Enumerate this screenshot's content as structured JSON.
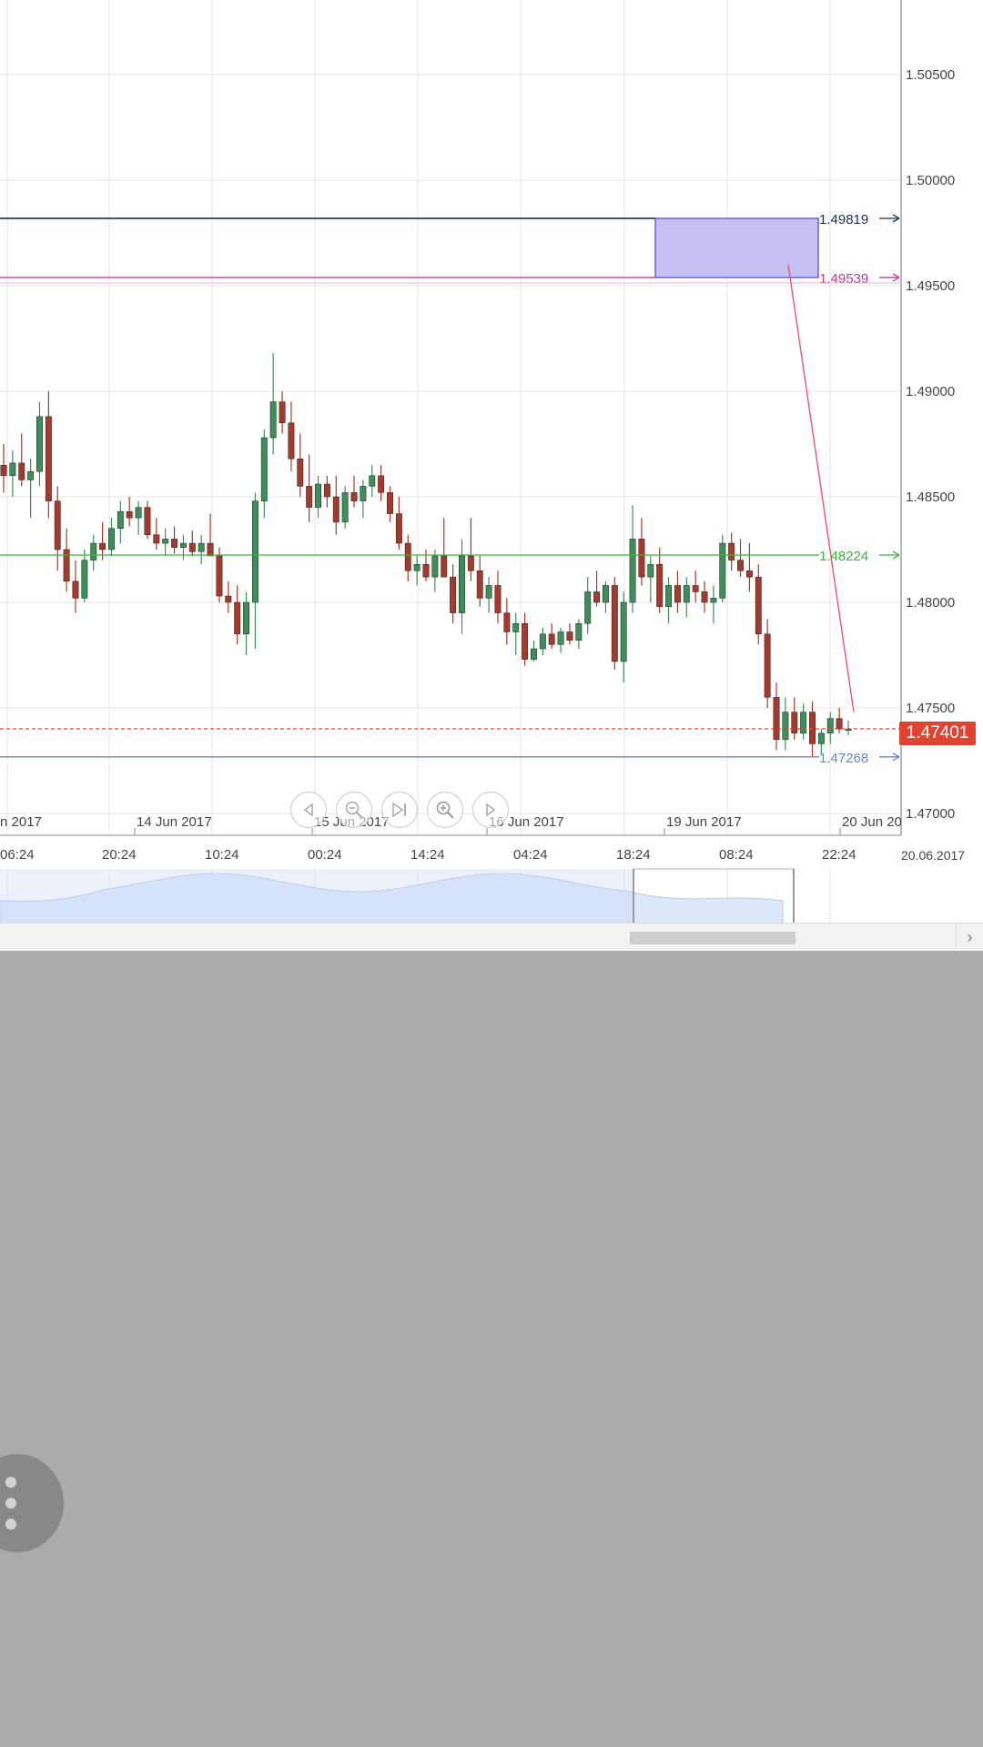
{
  "chart_data": {
    "type": "candlestick",
    "y_axis_ticks": [
      "1.50500",
      "1.50000",
      "1.49500",
      "1.49000",
      "1.48500",
      "1.48000",
      "1.47500",
      "1.47000"
    ],
    "y_axis_values": [
      1.505,
      1.5,
      1.495,
      1.49,
      1.485,
      1.48,
      1.475,
      1.47
    ],
    "ylim": [
      1.4684,
      1.5089
    ],
    "date_labels": [
      "n 2017",
      "14 Jun 2017",
      "15 Jun 2017",
      "16 Jun 2017",
      "19 Jun 2017",
      "20 Jun 20"
    ],
    "time_labels": [
      "06:24",
      "20:24",
      "10:24",
      "00:24",
      "14:24",
      "04:24",
      "18:24",
      "08:24",
      "22:24"
    ],
    "corner_date": "20.06.2017",
    "current_price": 1.47401,
    "current_price_label": "1.47401",
    "horizontal_lines": [
      {
        "value": 1.49819,
        "label": "1.49819",
        "color": "#1f2a5a"
      },
      {
        "value": 1.49539,
        "label": "1.49539",
        "color": "#c23a8c"
      },
      {
        "value": 1.48224,
        "label": "1.48224",
        "color": "#3cb33c"
      },
      {
        "value": 1.47268,
        "label": "1.47268",
        "color": "#6a86c8"
      }
    ],
    "rectangle_zone": {
      "from": 1.49539,
      "to": 1.49819
    },
    "grid": true,
    "colors": {
      "up": "#3e8e5a",
      "down": "#a53a2c",
      "price_badge": "#e0432f",
      "zone_fill": "#c6c0f3",
      "zone_stroke": "#6d5ce0",
      "trend_line": "#e8557a"
    }
  },
  "navigator": {
    "buttons": [
      "previous",
      "zoom-out",
      "jump-to-latest",
      "zoom-in",
      "next"
    ]
  }
}
